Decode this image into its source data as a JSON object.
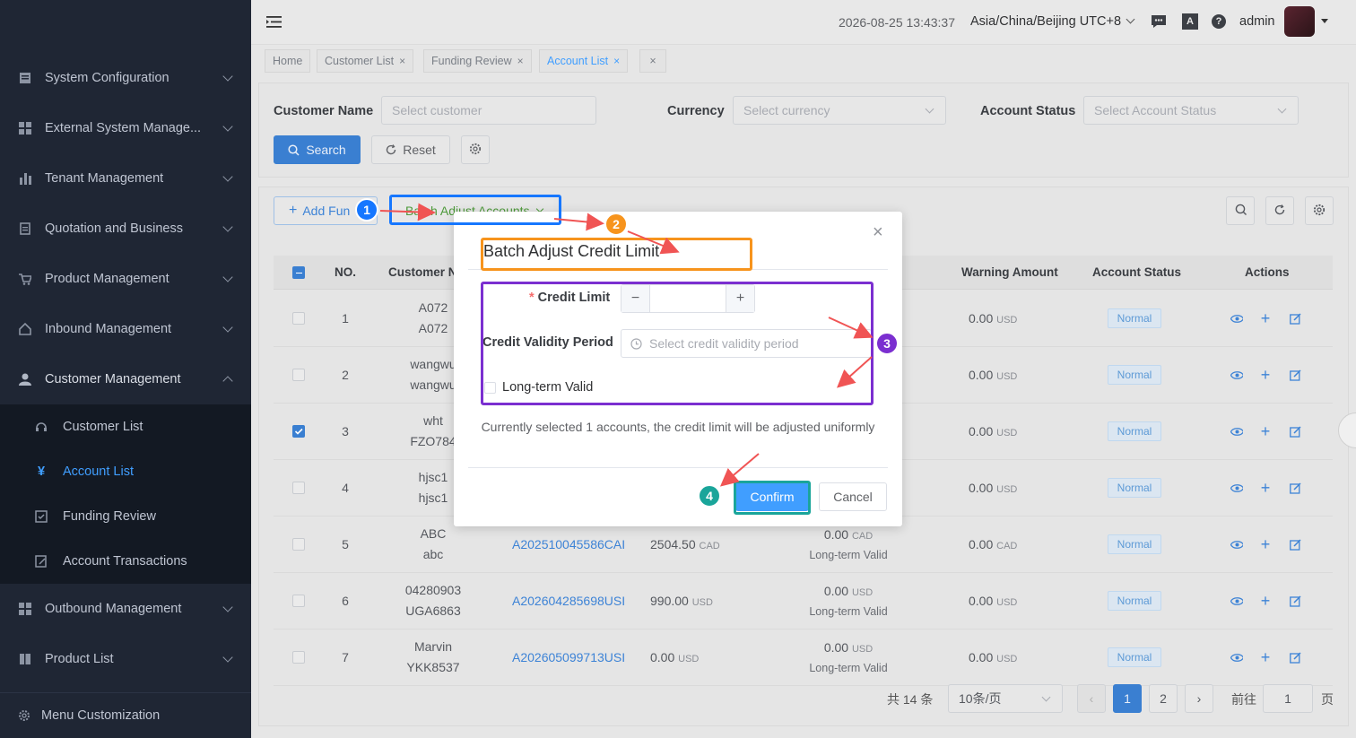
{
  "sidebar": {
    "menu": [
      {
        "label": "System Configuration",
        "icon": "document-icon"
      },
      {
        "label": "External System Manage...",
        "icon": "grid-icon"
      },
      {
        "label": "Tenant Management",
        "icon": "bar-chart-icon"
      },
      {
        "label": "Quotation and Business",
        "icon": "file-icon"
      },
      {
        "label": "Product Management",
        "icon": "cart-icon"
      },
      {
        "label": "Inbound Management",
        "icon": "home-icon"
      },
      {
        "label": "Customer Management",
        "icon": "user-icon"
      }
    ],
    "submenu": [
      {
        "label": "Customer List",
        "icon": "headset-icon"
      },
      {
        "label": "Account List",
        "icon": "yen-icon"
      },
      {
        "label": "Funding Review",
        "icon": "check-square-icon"
      },
      {
        "label": "Account Transactions",
        "icon": "edit-doc-icon"
      }
    ],
    "menu_after": [
      {
        "label": "Outbound Management",
        "icon": "grid-icon"
      },
      {
        "label": "Product List",
        "icon": "book-icon"
      }
    ],
    "footer": "Menu Customization"
  },
  "header": {
    "datetime": "2026-08-25 13:43:37",
    "timezone": "Asia/China/Beijing UTC+8",
    "user": "admin"
  },
  "tabs": [
    {
      "label": "Home"
    },
    {
      "label": "Customer List"
    },
    {
      "label": "Funding Review"
    },
    {
      "label": "Account List"
    }
  ],
  "filters": {
    "customer_name_label": "Customer Name",
    "customer_name_placeholder": "Select customer",
    "currency_label": "Currency",
    "currency_placeholder": "Select currency",
    "status_label": "Account Status",
    "status_placeholder": "Select Account Status",
    "search": "Search",
    "reset": "Reset"
  },
  "toolbar": {
    "add_funds": "Add Fun",
    "batch_adjust": "Batch Adjust Accounts"
  },
  "table": {
    "headers": {
      "no": "NO.",
      "customer": "Customer N",
      "warning": "Warning Amount",
      "status": "Account Status",
      "actions": "Actions"
    },
    "rows": [
      {
        "no": "1",
        "name1": "A072",
        "name2": "A072",
        "account": "",
        "balance": "",
        "bunit": "",
        "credit": "",
        "cunit": "",
        "validity": "",
        "warning": "0.00",
        "wunit": "USD",
        "status": "Normal",
        "checked": false
      },
      {
        "no": "2",
        "name1": "wangwu",
        "name2": "wangwu",
        "account": "",
        "balance": "",
        "bunit": "",
        "credit": "",
        "cunit": "",
        "validity": "",
        "warning": "0.00",
        "wunit": "USD",
        "status": "Normal",
        "checked": false
      },
      {
        "no": "3",
        "name1": "wht",
        "name2": "FZO784",
        "account": "",
        "balance": "",
        "bunit": "",
        "credit": "",
        "cunit": "",
        "validity": "",
        "warning": "0.00",
        "wunit": "USD",
        "status": "Normal",
        "checked": true
      },
      {
        "no": "4",
        "name1": "hjsc1",
        "name2": "hjsc1",
        "account": "",
        "balance": "",
        "bunit": "",
        "credit": "",
        "cunit": "",
        "validity": "",
        "warning": "0.00",
        "wunit": "USD",
        "status": "Normal",
        "checked": false
      },
      {
        "no": "5",
        "name1": "ABC",
        "name2": "abc",
        "account": "A202510045586CAI",
        "balance": "2504.50",
        "bunit": "CAD",
        "credit": "0.00",
        "cunit": "CAD",
        "validity": "Long-term Valid",
        "warning": "0.00",
        "wunit": "CAD",
        "status": "Normal",
        "checked": false
      },
      {
        "no": "6",
        "name1": "04280903",
        "name2": "UGA6863",
        "account": "A202604285698USI",
        "balance": "990.00",
        "bunit": "USD",
        "credit": "0.00",
        "cunit": "USD",
        "validity": "Long-term Valid",
        "warning": "0.00",
        "wunit": "USD",
        "status": "Normal",
        "checked": false
      },
      {
        "no": "7",
        "name1": "Marvin",
        "name2": "YKK8537",
        "account": "A202605099713USI",
        "balance": "0.00",
        "bunit": "USD",
        "credit": "0.00",
        "cunit": "USD",
        "validity": "Long-term Valid",
        "warning": "0.00",
        "wunit": "USD",
        "status": "Normal",
        "checked": false
      }
    ]
  },
  "pagination": {
    "total": "共 14 条",
    "page_size": "10条/页",
    "pages": [
      "1",
      "2"
    ],
    "goto_label": "前往",
    "goto_value": "1",
    "page_suffix": "页"
  },
  "modal": {
    "title": "Batch Adjust Credit Limit",
    "credit_limit_label": "Credit Limit",
    "credit_limit_value": "",
    "validity_label": "Credit Validity Period",
    "validity_placeholder": "Select credit validity period",
    "long_term_label": "Long-term Valid",
    "note": "Currently selected 1 accounts, the credit limit will be adjusted uniformly",
    "confirm": "Confirm",
    "cancel": "Cancel"
  },
  "markers": [
    {
      "label": "1",
      "color": "#1677ff"
    },
    {
      "label": "2",
      "color": "#f7941d"
    },
    {
      "label": "3",
      "color": "#7b2fd0"
    },
    {
      "label": "4",
      "color": "#1aa59a"
    }
  ],
  "colors": {
    "sidebar": "#1f2634",
    "accent": "#409eff",
    "primary": "#3a7fd1",
    "annotation_arrow": "#f05454"
  }
}
